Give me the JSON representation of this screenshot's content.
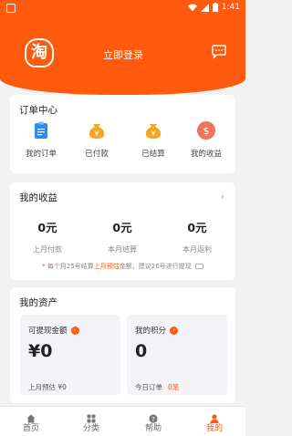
{
  "status_bar": {
    "time": "1:41"
  },
  "header": {
    "logo_char": "淘",
    "login_label": "立即登录"
  },
  "orders": {
    "title": "订单中心",
    "items": [
      {
        "label": "我的订单",
        "icon": "clipboard-icon",
        "color": "#2d8cf0"
      },
      {
        "label": "已付款",
        "icon": "money-bag-icon",
        "color": "#f5a623"
      },
      {
        "label": "已结算",
        "icon": "money-bag-icon",
        "color": "#f5a623"
      },
      {
        "label": "我的收益",
        "icon": "dollar-coin-icon",
        "color": "#f0735a"
      }
    ]
  },
  "earnings": {
    "title": "我的收益",
    "stats": [
      {
        "value": "0元",
        "label": "上月付款"
      },
      {
        "value": "0元",
        "label": "本月结算"
      },
      {
        "value": "0元",
        "label": "本月返利"
      }
    ],
    "note": {
      "star": "*",
      "part1": " 每个月25号结算",
      "highlight": "上月预估",
      "part2": "金额，建议26号进行提现"
    }
  },
  "assets": {
    "title": "我的资产",
    "withdraw": {
      "label": "可提现金额",
      "value": "¥0",
      "sub": "上月预估 ¥0"
    },
    "points": {
      "label": "我的积分",
      "value": "0",
      "sub": "今日订单",
      "sub_highlight": "0笔"
    }
  },
  "tabbar": {
    "items": [
      {
        "label": "首页",
        "icon": "home-icon"
      },
      {
        "label": "分类",
        "icon": "category-grid-icon"
      },
      {
        "label": "帮助",
        "icon": "help-icon"
      },
      {
        "label": "我的",
        "icon": "person-icon"
      }
    ],
    "active_index": 3
  },
  "colors": {
    "brand": "#ff5a0d",
    "background": "#f2f2f2"
  }
}
